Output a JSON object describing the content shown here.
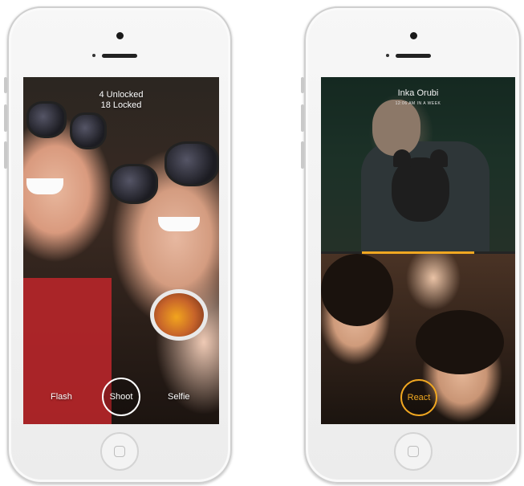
{
  "left_phone": {
    "counter": {
      "unlocked": "4 Unlocked",
      "locked": "18 Locked"
    },
    "controls": {
      "flash": "Flash",
      "shoot": "Shoot",
      "selfie": "Selfie"
    }
  },
  "right_phone": {
    "sender": {
      "name": "Inka Orubi",
      "time": "12:06 AM IN A WEEK"
    },
    "progress": 0.58,
    "controls": {
      "react": "React"
    }
  },
  "colors": {
    "accent": "#f0a721",
    "shoot_ring": "#ffffff"
  }
}
